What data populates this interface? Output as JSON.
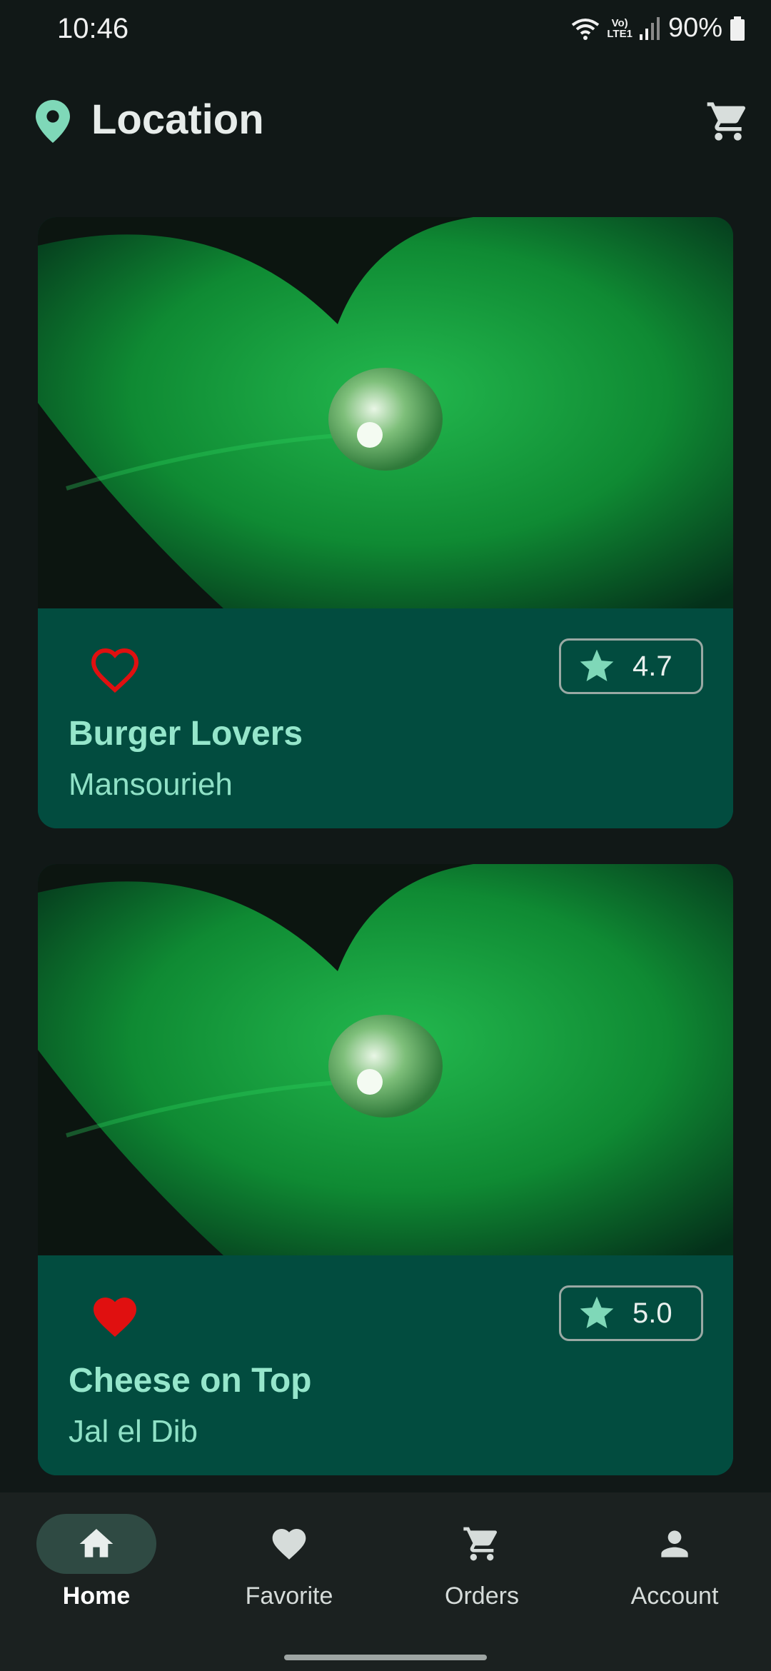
{
  "status": {
    "time": "10:46",
    "network": "LTE1",
    "battery": "90%"
  },
  "header": {
    "title": "Location",
    "location_icon": "location-pin-icon",
    "cart_icon": "shopping-cart-icon"
  },
  "restaurants": [
    {
      "name": "Burger Lovers",
      "location": "Mansourieh",
      "rating": "4.7",
      "favorited": false
    },
    {
      "name": "Cheese on Top",
      "location": "Jal el Dib",
      "rating": "5.0",
      "favorited": true
    }
  ],
  "nav": {
    "items": [
      {
        "label": "Home",
        "icon": "home-icon",
        "active": true
      },
      {
        "label": "Favorite",
        "icon": "heart-icon",
        "active": false
      },
      {
        "label": "Orders",
        "icon": "shopping-cart-icon",
        "active": false
      },
      {
        "label": "Account",
        "icon": "person-icon",
        "active": false
      }
    ]
  },
  "colors": {
    "background": "#111817",
    "card": "#024c3f",
    "accent_text": "#95e6cb",
    "favorite": "#e01010",
    "star": "#7fd8b8",
    "nav_background": "#1b2120"
  }
}
